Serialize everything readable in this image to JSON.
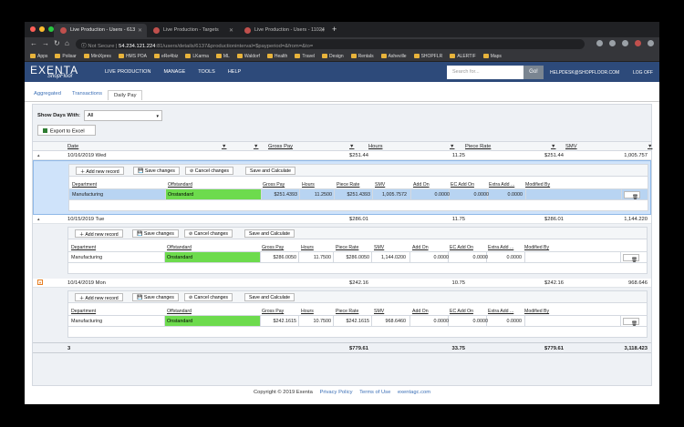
{
  "browser": {
    "tabs": [
      {
        "title": "Live Production - Users - 613"
      },
      {
        "title": "Live Production - Targets"
      },
      {
        "title": "Live Production - Users - 11024"
      }
    ],
    "new_tab": "+",
    "url_secure": "Not Secure",
    "url_host": "54.234.121.224",
    "url_path": ":81/users/details/6137&productioninterval=$payperiod=&from=&to=",
    "bookmarks": [
      "Apps",
      "Polisar",
      "MiniXpres",
      "HMS POA",
      "eRe4biz",
      "LKarma",
      "ML",
      "Waldorf",
      "Health",
      "Travel",
      "Design",
      "Rentals",
      "Asheville",
      "SHOPFLR",
      "ALERTIF",
      "Maps"
    ]
  },
  "app": {
    "logo": "EXENTA",
    "logo_sub": "ShopFloor",
    "menu": [
      "LIVE PRODUCTION",
      "MANAGE",
      "TOOLS",
      "HELP"
    ],
    "search_placeholder": "Search for...",
    "go_label": "Go!",
    "helpdesk": "HELPDESK@SHOPFLOOR.COM",
    "logoff": "LOG OFF"
  },
  "subtabs": [
    "Aggregated",
    "Transactions",
    "Daily Pay"
  ],
  "filter": {
    "label": "Show Days With:",
    "value": "All",
    "export_label": "Export to Excel"
  },
  "grid": {
    "columns": [
      "Date",
      "Gross Pay",
      "Hours",
      "Piece Rate",
      "SMV"
    ],
    "filter_icon": "▼",
    "rows": [
      {
        "date": "10/16/2019 Wed",
        "gross": "$251.44",
        "hours": "11.25",
        "rate": "$251.44",
        "smv": "1,005.757",
        "detail": {
          "dept": "Manufacturing",
          "off": "Onstandard",
          "gross": "$251.4393",
          "hours": "11.2500",
          "rate": "$251.4393",
          "smv": "1,005.7572",
          "addon": "0.0000",
          "ec": "0.0000",
          "extra": "0.0000"
        }
      },
      {
        "date": "10/15/2019 Tue",
        "gross": "$286.01",
        "hours": "11.75",
        "rate": "$286.01",
        "smv": "1,144.220",
        "detail": {
          "dept": "Manufacturing",
          "off": "Onstandard",
          "gross": "$286.0050",
          "hours": "11.7500",
          "rate": "$286.0050",
          "smv": "1,144.0200",
          "addon": "0.0000",
          "ec": "0.0000",
          "extra": "0.0000"
        }
      },
      {
        "date": "10/14/2019 Mon",
        "gross": "$242.16",
        "hours": "10.75",
        "rate": "$242.16",
        "smv": "968.646",
        "detail": {
          "dept": "Manufacturing",
          "off": "Onstandard",
          "gross": "$242.1615",
          "hours": "10.7500",
          "rate": "$242.1615",
          "smv": "968.6460",
          "addon": "0.0000",
          "ec": "0.0000",
          "extra": "0.0000"
        }
      }
    ],
    "totals": {
      "count": "3",
      "gross": "$779.61",
      "hours": "33.75",
      "rate": "$779.61",
      "smv": "3,118.423"
    }
  },
  "detail_toolbar": [
    "Add new record",
    "Save changes",
    "Cancel changes",
    "Save and Calculate"
  ],
  "detail_columns": [
    "Department",
    "Offstandard",
    "Gross Pay",
    "Hours",
    "Piece Rate",
    "SMV",
    "Add On",
    "EC Add On",
    "Extra Add ...",
    "Modified By"
  ],
  "footer": {
    "copyright": "Copyright © 2019 Exenta",
    "privacy": "Privacy Policy",
    "terms": "Terms of Use",
    "site": "exentagc.com"
  },
  "colors": {
    "header": "#2d4a7a",
    "onstandard": "#6ddb4d",
    "selected_row": "#b8d4f2"
  }
}
